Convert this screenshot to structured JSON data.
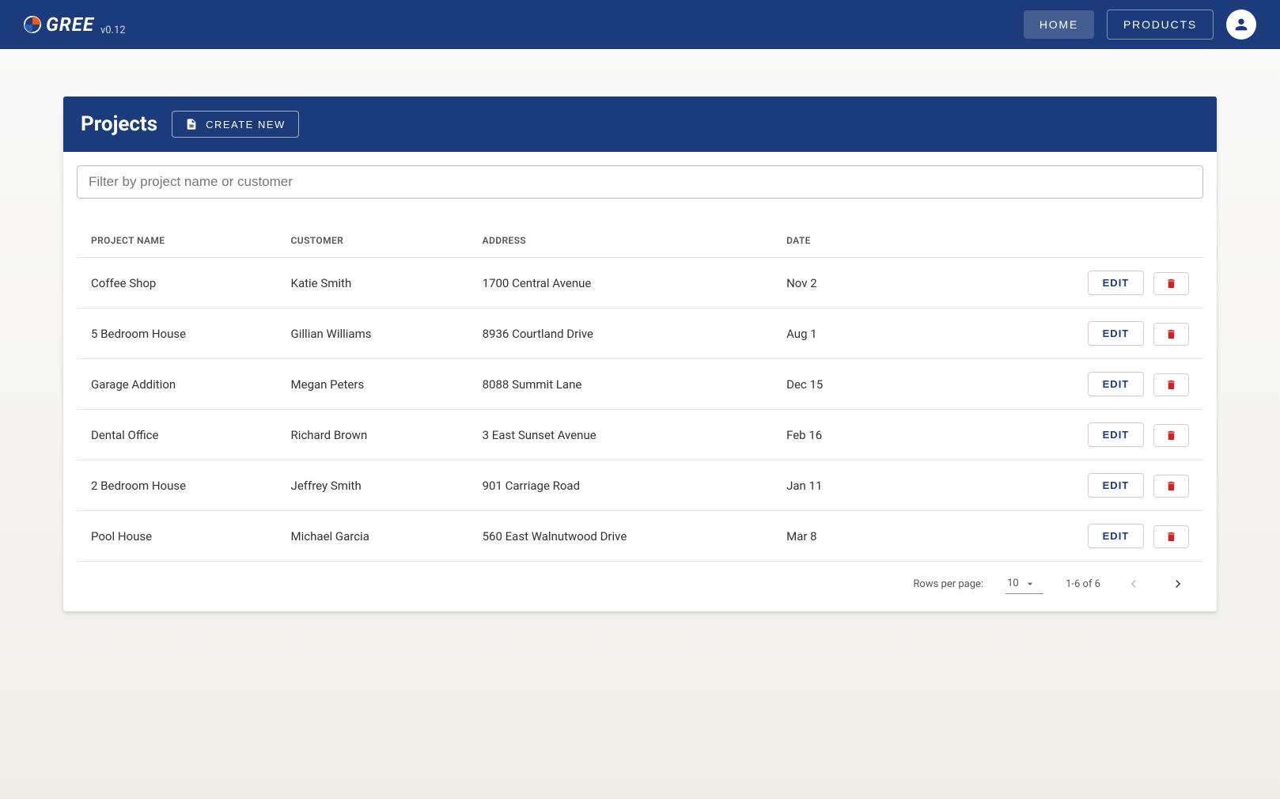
{
  "nav": {
    "brand_name": "GREE",
    "version": "v0.12",
    "home_label": "HOME",
    "products_label": "PRODUCTS"
  },
  "page": {
    "title": "Projects",
    "create_label": "CREATE NEW",
    "filter_placeholder": "Filter by project name or customer"
  },
  "table": {
    "headers": {
      "project_name": "PROJECT NAME",
      "customer": "CUSTOMER",
      "address": "ADDRESS",
      "date": "DATE"
    },
    "edit_label": "EDIT",
    "rows": [
      {
        "name": "Coffee Shop",
        "customer": "Katie Smith",
        "address": "1700 Central Avenue",
        "date": "Nov 2"
      },
      {
        "name": "5 Bedroom House",
        "customer": "Gillian Williams",
        "address": "8936 Courtland Drive",
        "date": "Aug 1"
      },
      {
        "name": "Garage Addition",
        "customer": "Megan Peters",
        "address": "8088 Summit Lane",
        "date": "Dec 15"
      },
      {
        "name": "Dental Office",
        "customer": "Richard Brown",
        "address": "3 East Sunset Avenue",
        "date": "Feb 16"
      },
      {
        "name": "2 Bedroom House",
        "customer": "Jeffrey Smith",
        "address": "901 Carriage Road",
        "date": "Jan 11"
      },
      {
        "name": "Pool House",
        "customer": "Michael Garcia",
        "address": "560 East Walnutwood Drive",
        "date": "Mar 8"
      }
    ]
  },
  "pagination": {
    "rows_per_page_label": "Rows per page:",
    "rows_per_page_value": "10",
    "range_text": "1-6 of 6"
  }
}
